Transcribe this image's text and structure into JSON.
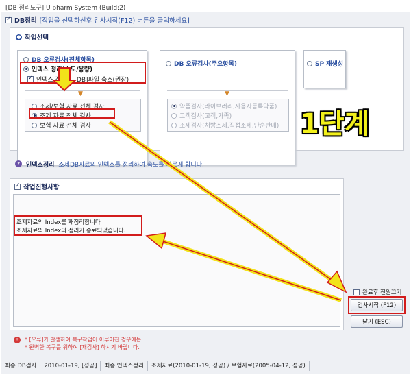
{
  "window": {
    "title": "[DB 정리도구] U pharm System (Build:2)"
  },
  "header": {
    "label": "DB정리",
    "hint": "[작업을 선택하신후 검사시작(F12) 버튼을 클릭하세요]"
  },
  "task_select": {
    "title": "작업선택",
    "group1": {
      "radio_main": "DB 오류검사(전체항목)",
      "radio_index": "인덱스 정리(속도/용량)",
      "check_shrink": "인덱스 정리후 [DB]파일 축소(권장)",
      "sub_options": [
        "조제/보험 자료 전체 검사",
        "조제 자료 전체 검사",
        "보험 자료 전체 검사"
      ]
    },
    "group2": {
      "radio_main": "DB 오류검사(주요항목)",
      "sub_options": [
        "약품검사(라이브러리,사용자등록약품)",
        "고객검사(고객,가족)",
        "조제검사(처방조제,직접조제,단순판매)"
      ]
    },
    "group3": {
      "radio_main": "SP 재생성"
    }
  },
  "info": {
    "title": "인덱스정리",
    "desc": "조제DB자료의 인덱스를 정리하여 속도를 빠르게 합니다."
  },
  "work": {
    "title": "작업진행사항",
    "log": [
      "조제자료의 Index를 재정리합니다",
      "조제자료의 Index의 정리가 종료되었습니다."
    ]
  },
  "options": {
    "power_off": "완료후 전원끄기"
  },
  "buttons": {
    "start": "검사시작 (F12)",
    "close": "닫기 (ESC)"
  },
  "warning": {
    "lines": [
      "* [오류]가 발생하여 복구작업이 이루어진 경우에는",
      "* 완벽한 복구를 위하여 [재검사] 하시기 바랍니다."
    ]
  },
  "status": {
    "last_check_label": "최종 DB검사",
    "last_check_value": "2010-01-19, [성공]",
    "last_index_label": "최종 인덱스정리",
    "last_index_value": "조제자료(2010-01-19, 성공) / 보험자료(2005-04-12, 성공)"
  },
  "annotation": {
    "stage": "1단계"
  },
  "colors": {
    "accent": "#2a4fa0",
    "highlight_red": "#d21c1c",
    "arrow_fill": "#f2e31a",
    "stage_text": "#f2f01a"
  },
  "icons": [
    "checkbox-icon",
    "section-icon",
    "help-icon",
    "warning-icon",
    "arrow-down-icon"
  ]
}
